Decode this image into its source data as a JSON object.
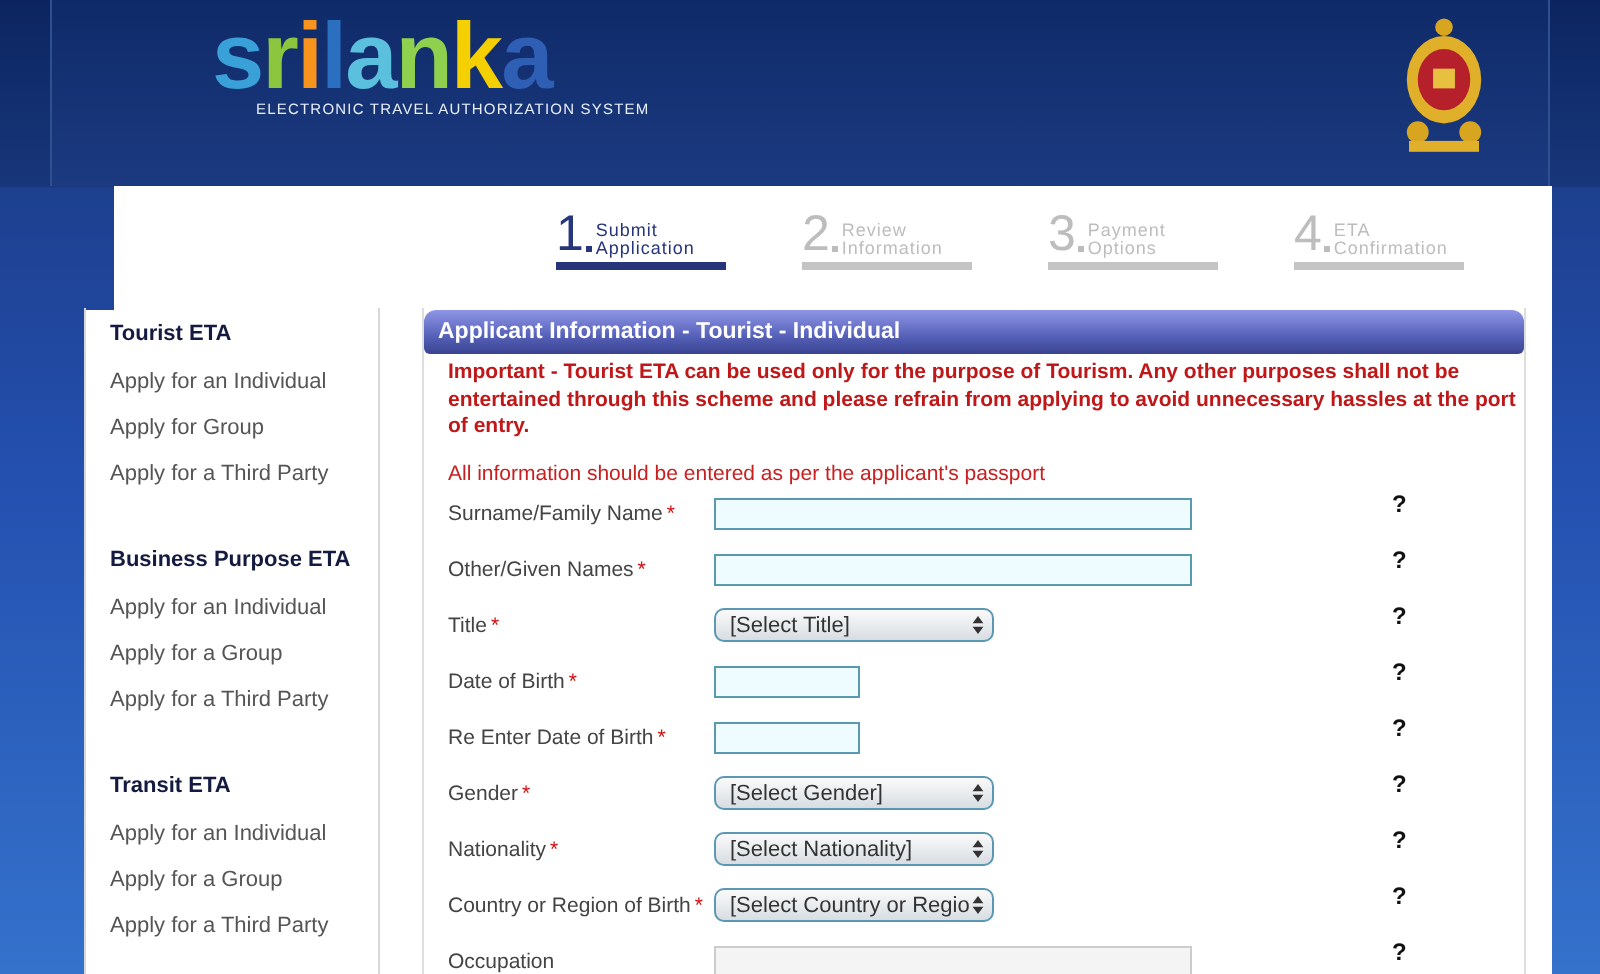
{
  "header": {
    "logo": "srilanka",
    "subtitle": "ELECTRONIC TRAVEL AUTHORIZATION SYSTEM"
  },
  "steps": [
    {
      "number": "1",
      "lines": [
        "Submit",
        "Application"
      ],
      "selected": true
    },
    {
      "number": "2",
      "lines": [
        "Review",
        "Information"
      ],
      "selected": false
    },
    {
      "number": "3",
      "lines": [
        "Payment",
        "Options"
      ],
      "selected": false
    },
    {
      "number": "4",
      "lines": [
        "ETA",
        "Confirmation"
      ],
      "selected": false
    }
  ],
  "sidebar": {
    "sections": [
      {
        "title": "Tourist ETA",
        "items": [
          "Apply for an Individual",
          "Apply for Group",
          "Apply for a Third Party"
        ]
      },
      {
        "title": "Business Purpose ETA",
        "items": [
          "Apply for an Individual",
          "Apply for a Group",
          "Apply for a Third Party"
        ]
      },
      {
        "title": "Transit ETA",
        "items": [
          "Apply for an Individual",
          "Apply for a Group",
          "Apply for a Third Party"
        ]
      }
    ]
  },
  "form": {
    "title": "Applicant Information - Tourist - Individual",
    "notice": "Important - Tourist ETA can be used only for the purpose of Tourism. Any other purposes shall not be entertained through this scheme and please refrain from applying to avoid unnecessary hassles at the port of entry.",
    "instruction": "All information should be entered as per the applicant's passport",
    "fields": [
      {
        "kind": "text",
        "label": "Surname/Family Name",
        "required_mark": "*",
        "help": "?",
        "disabled": false
      },
      {
        "kind": "text",
        "label": "Other/Given Names",
        "required_mark": "*",
        "help": "?",
        "disabled": false
      },
      {
        "kind": "select",
        "label": "Title",
        "required_mark": "*",
        "value": "[Select Title]",
        "help": "?",
        "disabled": false
      },
      {
        "kind": "date",
        "label": "Date of Birth",
        "required_mark": "*",
        "help": "?",
        "disabled": false
      },
      {
        "kind": "date",
        "label": "Re Enter Date of Birth",
        "required_mark": "*",
        "help": "?",
        "disabled": false
      },
      {
        "kind": "select",
        "label": "Gender",
        "required_mark": "*",
        "value": "[Select Gender]",
        "help": "?",
        "disabled": false
      },
      {
        "kind": "select",
        "label": "Nationality",
        "required_mark": "*",
        "value": "[Select Nationality]",
        "help": "?",
        "disabled": false
      },
      {
        "kind": "select",
        "label": "Country or Region of Birth",
        "required_mark": "*",
        "value": "[Select Country or Regio",
        "help": "?",
        "disabled": false
      },
      {
        "kind": "text",
        "label": "Occupation",
        "help": "?",
        "disabled": true
      }
    ]
  }
}
